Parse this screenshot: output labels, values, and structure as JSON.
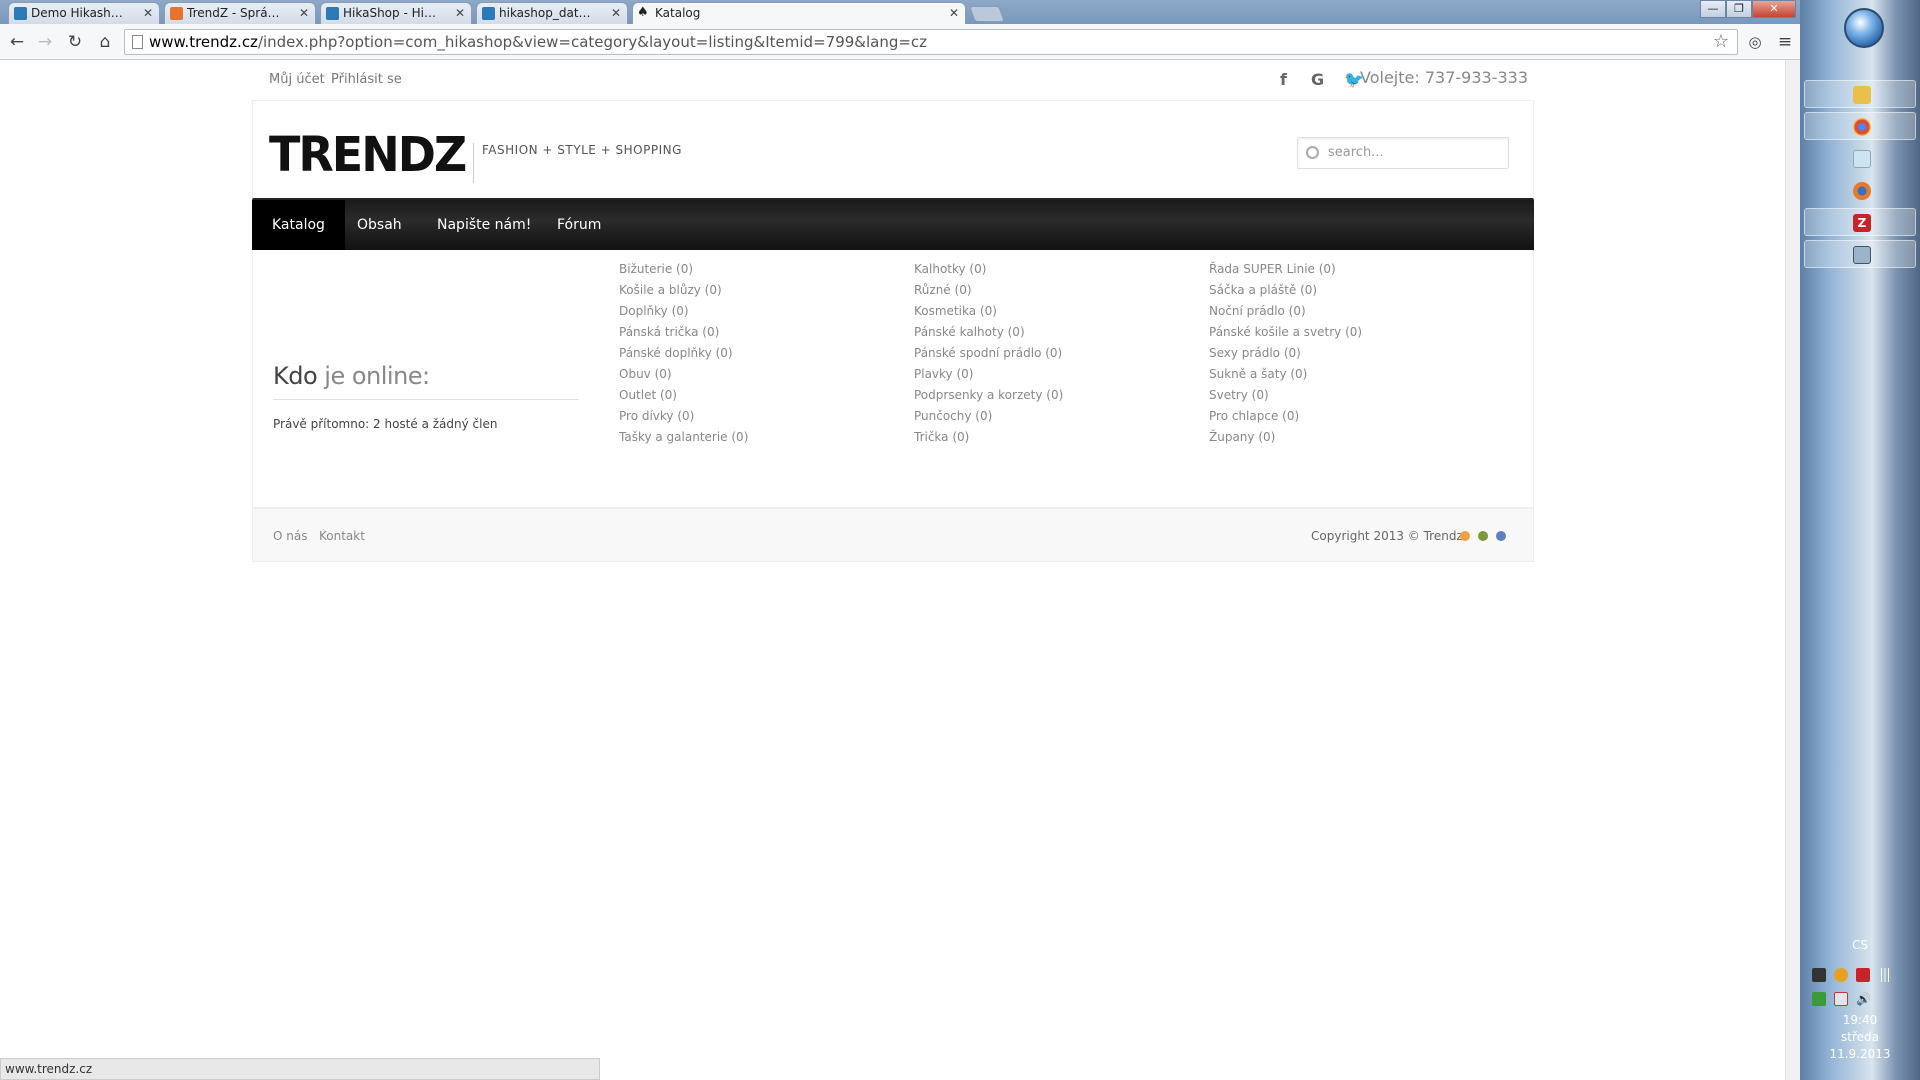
{
  "browser": {
    "tabs": [
      {
        "title": "Demo Hikashop",
        "active": false
      },
      {
        "title": "TrendZ - Správa",
        "active": false
      },
      {
        "title": "HikaShop - HikaShop - Re",
        "active": false
      },
      {
        "title": "hikashop_database.png (",
        "active": false
      },
      {
        "title": "Katalog",
        "active": true
      }
    ],
    "url_domain": "www.trendz.cz",
    "url_path": "/index.php?option=com_hikashop&view=category&layout=listing&Itemid=799&lang=cz",
    "status_text": "www.trendz.cz"
  },
  "site": {
    "top_links": {
      "account": "Můj účet",
      "login": "Přihlásit se"
    },
    "phone": "Volejte: 737-933-333",
    "logo": "TRENDZ",
    "tagline": "FASHION + STYLE + SHOPPING",
    "search_placeholder": "search...",
    "nav": [
      "Katalog",
      "Obsah",
      "Napište nám!",
      "Fórum"
    ],
    "online": {
      "title_dark": "Kdo",
      "title_light": " je online:",
      "text": "Právě přítomno: 2 hosté a žádný člen"
    },
    "categories": [
      [
        "Bižuterie (0)",
        "Košile a blůzy (0)",
        "Doplňky (0)",
        "Pánská trička (0)",
        "Pánské doplňky (0)",
        "Obuv (0)",
        "Outlet (0)",
        "Pro dívky (0)",
        "Tašky a galanterie (0)"
      ],
      [
        "Kalhotky (0)",
        "Různé (0)",
        "Kosmetika (0)",
        "Pánské kalhoty (0)",
        "Pánské spodní prádlo (0)",
        "Plavky (0)",
        "Podprsenky a korzety (0)",
        "Punčochy (0)",
        "Trička (0)"
      ],
      [
        "Řada SUPER Linie (0)",
        "Sáčka a pláště (0)",
        "Noční prádlo (0)",
        "Pánské košile a svetry (0)",
        "Sexy prádlo (0)",
        "Sukně a šaty (0)",
        "Svetry (0)",
        "Pro chlapce (0)",
        "Župany (0)"
      ]
    ],
    "footer": {
      "links": [
        "O nás",
        "Kontakt"
      ],
      "copyright": "Copyright 2013 © Trendz",
      "dots": [
        "#f0a040",
        "#7a9a3a",
        "#5a7fc0"
      ]
    }
  },
  "taskbar": {
    "language": "CS",
    "time": "19:40",
    "day": "středa",
    "date": "11.9.2013"
  },
  "colors": {
    "nav_bg": "#1a1a1a",
    "link_gray": "#888888"
  }
}
